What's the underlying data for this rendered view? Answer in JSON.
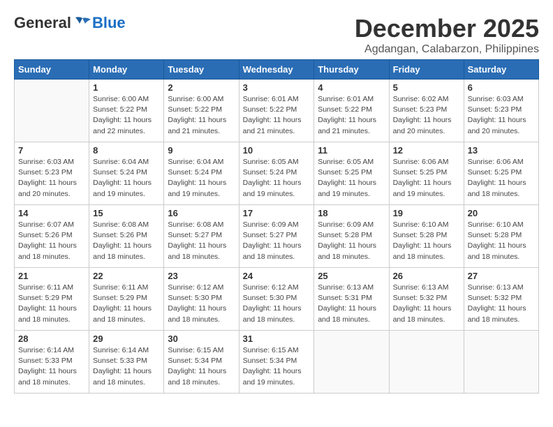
{
  "header": {
    "logo_general": "General",
    "logo_blue": "Blue",
    "month": "December 2025",
    "location": "Agdangan, Calabarzon, Philippines"
  },
  "weekdays": [
    "Sunday",
    "Monday",
    "Tuesday",
    "Wednesday",
    "Thursday",
    "Friday",
    "Saturday"
  ],
  "weeks": [
    [
      {
        "day": "",
        "sunrise": "",
        "sunset": "",
        "daylight": ""
      },
      {
        "day": "1",
        "sunrise": "Sunrise: 6:00 AM",
        "sunset": "Sunset: 5:22 PM",
        "daylight": "Daylight: 11 hours and 22 minutes."
      },
      {
        "day": "2",
        "sunrise": "Sunrise: 6:00 AM",
        "sunset": "Sunset: 5:22 PM",
        "daylight": "Daylight: 11 hours and 21 minutes."
      },
      {
        "day": "3",
        "sunrise": "Sunrise: 6:01 AM",
        "sunset": "Sunset: 5:22 PM",
        "daylight": "Daylight: 11 hours and 21 minutes."
      },
      {
        "day": "4",
        "sunrise": "Sunrise: 6:01 AM",
        "sunset": "Sunset: 5:22 PM",
        "daylight": "Daylight: 11 hours and 21 minutes."
      },
      {
        "day": "5",
        "sunrise": "Sunrise: 6:02 AM",
        "sunset": "Sunset: 5:23 PM",
        "daylight": "Daylight: 11 hours and 20 minutes."
      },
      {
        "day": "6",
        "sunrise": "Sunrise: 6:03 AM",
        "sunset": "Sunset: 5:23 PM",
        "daylight": "Daylight: 11 hours and 20 minutes."
      }
    ],
    [
      {
        "day": "7",
        "sunrise": "Sunrise: 6:03 AM",
        "sunset": "Sunset: 5:23 PM",
        "daylight": "Daylight: 11 hours and 20 minutes."
      },
      {
        "day": "8",
        "sunrise": "Sunrise: 6:04 AM",
        "sunset": "Sunset: 5:24 PM",
        "daylight": "Daylight: 11 hours and 19 minutes."
      },
      {
        "day": "9",
        "sunrise": "Sunrise: 6:04 AM",
        "sunset": "Sunset: 5:24 PM",
        "daylight": "Daylight: 11 hours and 19 minutes."
      },
      {
        "day": "10",
        "sunrise": "Sunrise: 6:05 AM",
        "sunset": "Sunset: 5:24 PM",
        "daylight": "Daylight: 11 hours and 19 minutes."
      },
      {
        "day": "11",
        "sunrise": "Sunrise: 6:05 AM",
        "sunset": "Sunset: 5:25 PM",
        "daylight": "Daylight: 11 hours and 19 minutes."
      },
      {
        "day": "12",
        "sunrise": "Sunrise: 6:06 AM",
        "sunset": "Sunset: 5:25 PM",
        "daylight": "Daylight: 11 hours and 19 minutes."
      },
      {
        "day": "13",
        "sunrise": "Sunrise: 6:06 AM",
        "sunset": "Sunset: 5:25 PM",
        "daylight": "Daylight: 11 hours and 18 minutes."
      }
    ],
    [
      {
        "day": "14",
        "sunrise": "Sunrise: 6:07 AM",
        "sunset": "Sunset: 5:26 PM",
        "daylight": "Daylight: 11 hours and 18 minutes."
      },
      {
        "day": "15",
        "sunrise": "Sunrise: 6:08 AM",
        "sunset": "Sunset: 5:26 PM",
        "daylight": "Daylight: 11 hours and 18 minutes."
      },
      {
        "day": "16",
        "sunrise": "Sunrise: 6:08 AM",
        "sunset": "Sunset: 5:27 PM",
        "daylight": "Daylight: 11 hours and 18 minutes."
      },
      {
        "day": "17",
        "sunrise": "Sunrise: 6:09 AM",
        "sunset": "Sunset: 5:27 PM",
        "daylight": "Daylight: 11 hours and 18 minutes."
      },
      {
        "day": "18",
        "sunrise": "Sunrise: 6:09 AM",
        "sunset": "Sunset: 5:28 PM",
        "daylight": "Daylight: 11 hours and 18 minutes."
      },
      {
        "day": "19",
        "sunrise": "Sunrise: 6:10 AM",
        "sunset": "Sunset: 5:28 PM",
        "daylight": "Daylight: 11 hours and 18 minutes."
      },
      {
        "day": "20",
        "sunrise": "Sunrise: 6:10 AM",
        "sunset": "Sunset: 5:28 PM",
        "daylight": "Daylight: 11 hours and 18 minutes."
      }
    ],
    [
      {
        "day": "21",
        "sunrise": "Sunrise: 6:11 AM",
        "sunset": "Sunset: 5:29 PM",
        "daylight": "Daylight: 11 hours and 18 minutes."
      },
      {
        "day": "22",
        "sunrise": "Sunrise: 6:11 AM",
        "sunset": "Sunset: 5:29 PM",
        "daylight": "Daylight: 11 hours and 18 minutes."
      },
      {
        "day": "23",
        "sunrise": "Sunrise: 6:12 AM",
        "sunset": "Sunset: 5:30 PM",
        "daylight": "Daylight: 11 hours and 18 minutes."
      },
      {
        "day": "24",
        "sunrise": "Sunrise: 6:12 AM",
        "sunset": "Sunset: 5:30 PM",
        "daylight": "Daylight: 11 hours and 18 minutes."
      },
      {
        "day": "25",
        "sunrise": "Sunrise: 6:13 AM",
        "sunset": "Sunset: 5:31 PM",
        "daylight": "Daylight: 11 hours and 18 minutes."
      },
      {
        "day": "26",
        "sunrise": "Sunrise: 6:13 AM",
        "sunset": "Sunset: 5:32 PM",
        "daylight": "Daylight: 11 hours and 18 minutes."
      },
      {
        "day": "27",
        "sunrise": "Sunrise: 6:13 AM",
        "sunset": "Sunset: 5:32 PM",
        "daylight": "Daylight: 11 hours and 18 minutes."
      }
    ],
    [
      {
        "day": "28",
        "sunrise": "Sunrise: 6:14 AM",
        "sunset": "Sunset: 5:33 PM",
        "daylight": "Daylight: 11 hours and 18 minutes."
      },
      {
        "day": "29",
        "sunrise": "Sunrise: 6:14 AM",
        "sunset": "Sunset: 5:33 PM",
        "daylight": "Daylight: 11 hours and 18 minutes."
      },
      {
        "day": "30",
        "sunrise": "Sunrise: 6:15 AM",
        "sunset": "Sunset: 5:34 PM",
        "daylight": "Daylight: 11 hours and 18 minutes."
      },
      {
        "day": "31",
        "sunrise": "Sunrise: 6:15 AM",
        "sunset": "Sunset: 5:34 PM",
        "daylight": "Daylight: 11 hours and 19 minutes."
      },
      {
        "day": "",
        "sunrise": "",
        "sunset": "",
        "daylight": ""
      },
      {
        "day": "",
        "sunrise": "",
        "sunset": "",
        "daylight": ""
      },
      {
        "day": "",
        "sunrise": "",
        "sunset": "",
        "daylight": ""
      }
    ]
  ]
}
